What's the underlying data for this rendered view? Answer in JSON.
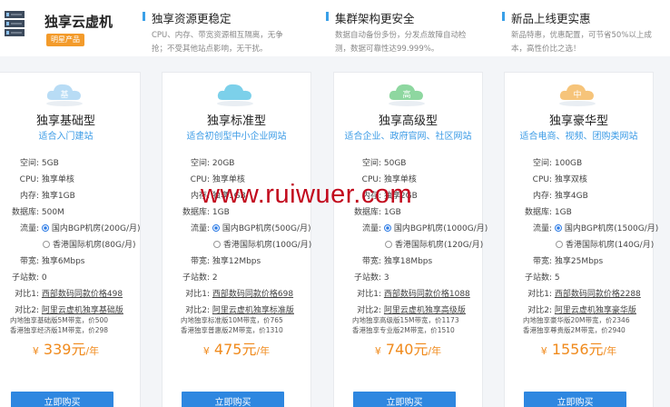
{
  "brand": {
    "title": "独享云虚机",
    "badge": "明星产品"
  },
  "features": [
    {
      "title": "独享资源更稳定",
      "desc1": "CPU、内存、带宽资源相互隔离，无争",
      "desc2": "抢；不受其他站点影响，无干扰。"
    },
    {
      "title": "集群架构更安全",
      "desc1": "数据自动备份多份，分发点故障自动检",
      "desc2": "测，数据可靠性达99.999%。"
    },
    {
      "title": "新品上线更实惠",
      "desc1": "新品特惠，优惠配置，可节省50%以上成",
      "desc2": "本，高性价比之选！"
    }
  ],
  "labels": {
    "space": "空间:",
    "cpu": "CPU:",
    "memory": "内存:",
    "db": "数据库:",
    "line": "流量:",
    "bandwidth": "带宽:",
    "sites": "子站数:",
    "cmp1": "对比1:",
    "cmp2": "对比2:"
  },
  "plans": [
    {
      "name": "独享基础型",
      "icon_name": "basic-cloud-icon",
      "icon_label": "基",
      "icon_color": "#b8dcf5",
      "sub": "适合入门建站",
      "space": "5GB",
      "cpu": "独享单核",
      "memory": "独享1GB",
      "db": "500M",
      "line1": "国内BGP机房(200G/月)",
      "line2": "香港国际机房(80G/月)",
      "bandwidth": "独享6Mbps",
      "sites": "0",
      "cmp1": "西部数码同款价格498",
      "cmp2": "阿里云虚机独享基础版",
      "note1": "内地独享基础版5M带宽，价500",
      "note2": "香港独享经济版1M带宽，价298",
      "price": "339元",
      "unit": "/年",
      "buy": "立即购买"
    },
    {
      "name": "独享标准型",
      "icon_name": "standard-cloud-icon",
      "icon_label": "",
      "icon_color": "#7cd0ea",
      "sub": "适合初创型中小企业网站",
      "space": "20GB",
      "cpu": "独享单核",
      "memory": "独享1GB",
      "db": "1GB",
      "line1": "国内BGP机房(500G/月)",
      "line2": "香港国际机房(100G/月)",
      "bandwidth": "独享12Mbps",
      "sites": "2",
      "cmp1": "西部数码同款价格698",
      "cmp2": "阿里云虚机独享标准版",
      "note1": "内地独享标准版10M带宽，价765",
      "note2": "香港独享普惠版2M带宽，价1310",
      "price": "475元",
      "unit": "/年",
      "buy": "立即购买"
    },
    {
      "name": "独享高级型",
      "icon_name": "advanced-cloud-icon",
      "icon_label": "高",
      "icon_color": "#8ed7a0",
      "sub": "适合企业、政府官网、社区网站",
      "space": "50GB",
      "cpu": "独享单核",
      "memory": "独享2GB",
      "db": "1GB",
      "line1": "国内BGP机房(1000G/月)",
      "line2": "香港国际机房(120G/月)",
      "bandwidth": "独享18Mbps",
      "sites": "3",
      "cmp1": "西部数码同款价格1088",
      "cmp2": "阿里云虚机独享高级版",
      "note1": "内地独享高级版15M带宽，价1173",
      "note2": "香港独享专业版2M带宽，价1510",
      "price": "740元",
      "unit": "/年",
      "buy": "立即购买"
    },
    {
      "name": "独享豪华型",
      "icon_name": "luxury-cloud-icon",
      "icon_label": "中",
      "icon_color": "#f6c47a",
      "sub": "适合电商、视频、团购类网站",
      "space": "100GB",
      "cpu": "独享双核",
      "memory": "独享4GB",
      "db": "1GB",
      "line1": "国内BGP机房(1500G/月)",
      "line2": "香港国际机房(140G/月)",
      "bandwidth": "独享25Mbps",
      "sites": "5",
      "cmp1": "西部数码同款价格2288",
      "cmp2": "阿里云虚机独享豪华版",
      "note1": "内地独享豪华版20M带宽，价2346",
      "note2": "香港独享尊贵版2M带宽，价2940",
      "price": "1556元",
      "unit": "/年",
      "buy": "立即购买"
    }
  ],
  "currency": "¥",
  "watermark": "www.ruiwuer.com"
}
